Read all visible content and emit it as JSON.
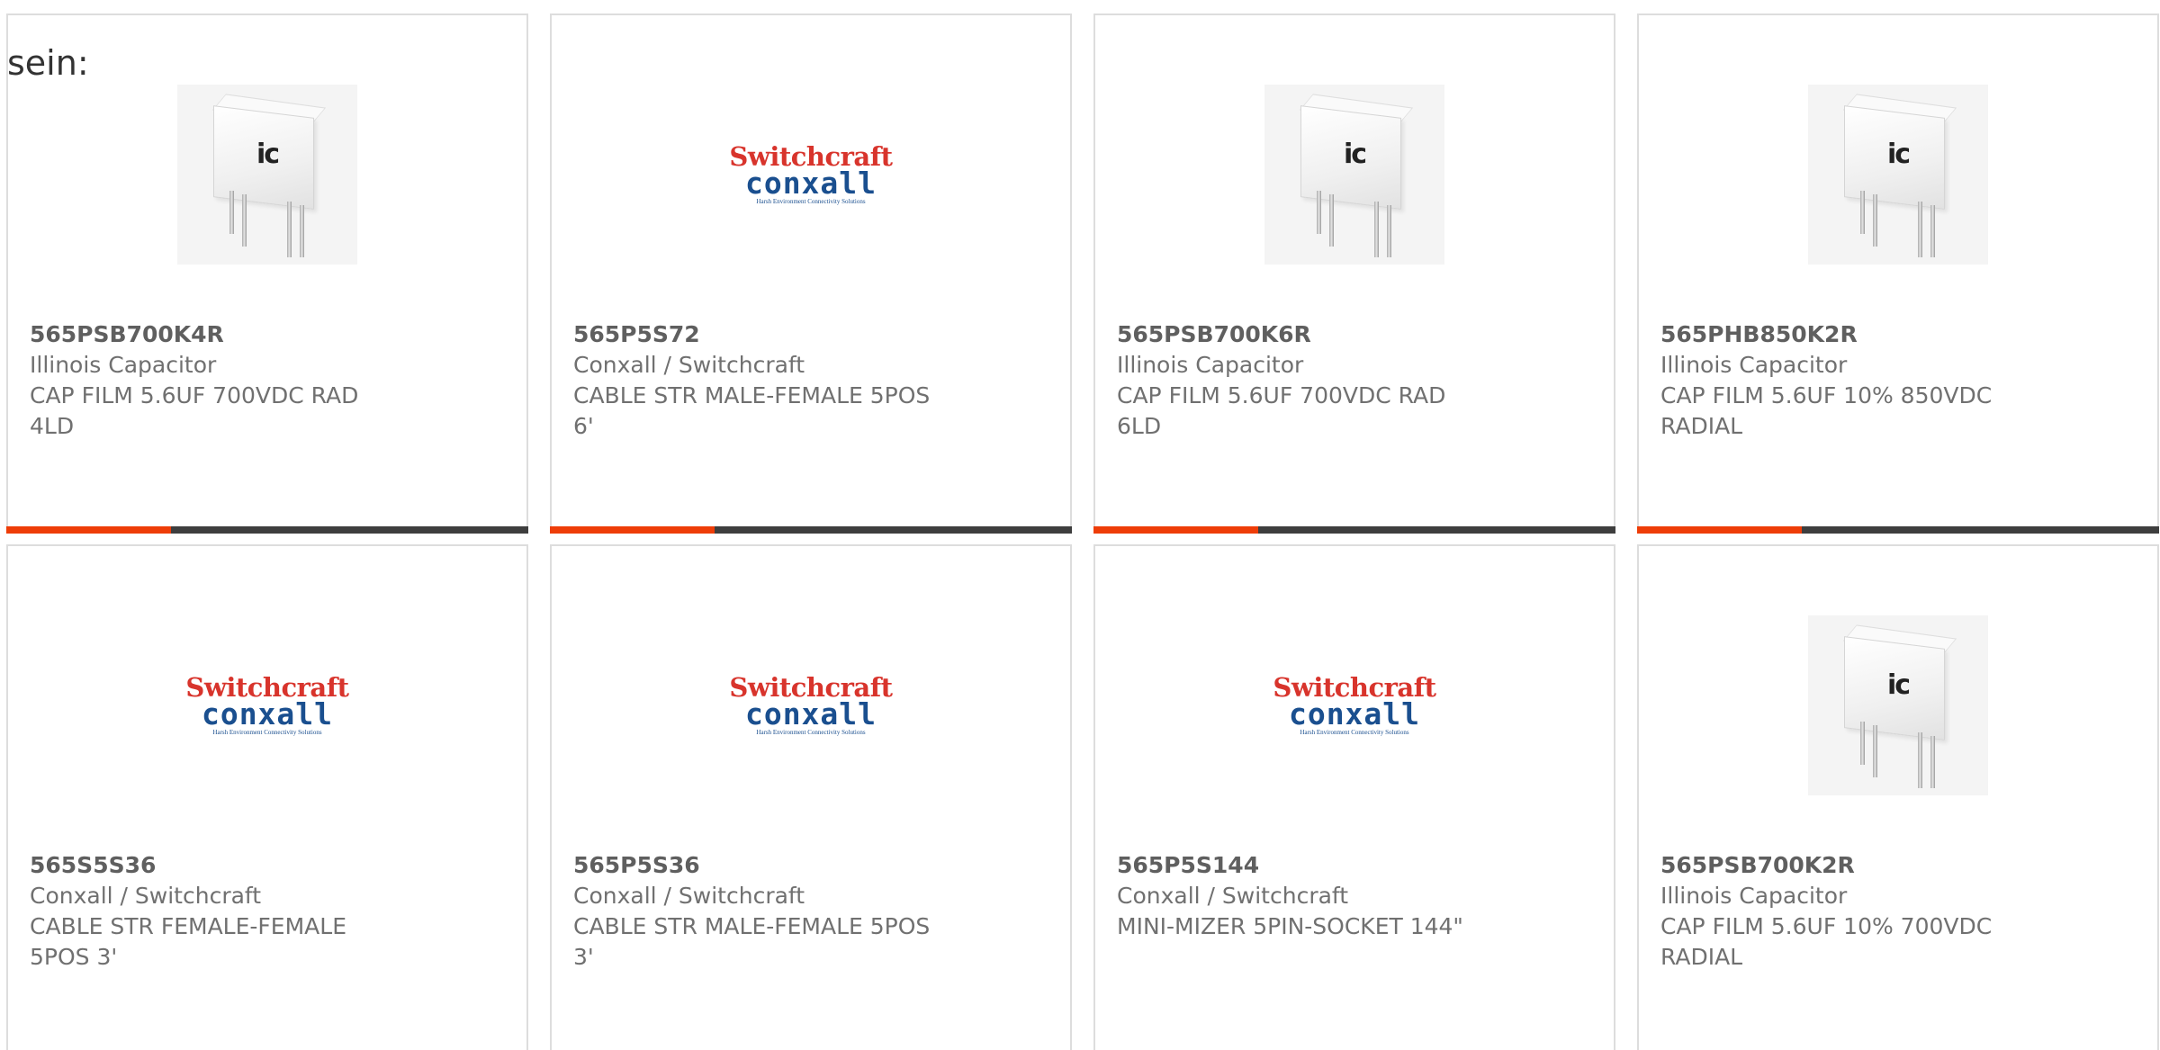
{
  "intro": {
    "text": "sein:"
  },
  "cards": [
    {
      "part_number": "565PSB700K4R",
      "manufacturer": "Illinois Capacitor",
      "description_line1": "CAP FILM 5.6UF 700VDC RAD",
      "description_line2": "4LD",
      "image": "ic-capacitor",
      "has_bar": true
    },
    {
      "part_number": "565P5S72",
      "manufacturer": "Conxall / Switchcraft",
      "description_line1": "CABLE STR MALE-FEMALE 5POS",
      "description_line2": "6'",
      "image": "switchcraft-conxall-logo",
      "has_bar": true
    },
    {
      "part_number": "565PSB700K6R",
      "manufacturer": "Illinois Capacitor",
      "description_line1": "CAP FILM 5.6UF 700VDC RAD",
      "description_line2": "6LD",
      "image": "ic-capacitor",
      "has_bar": true
    },
    {
      "part_number": "565PHB850K2R",
      "manufacturer": "Illinois Capacitor",
      "description_line1": "CAP FILM 5.6UF 10% 850VDC",
      "description_line2": "RADIAL",
      "image": "ic-capacitor",
      "has_bar": true
    },
    {
      "part_number": "565S5S36",
      "manufacturer": "Conxall / Switchcraft",
      "description_line1": "CABLE STR FEMALE-FEMALE",
      "description_line2": "5POS 3'",
      "image": "switchcraft-conxall-logo",
      "has_bar": false
    },
    {
      "part_number": "565P5S36",
      "manufacturer": "Conxall / Switchcraft",
      "description_line1": "CABLE STR MALE-FEMALE 5POS",
      "description_line2": "3'",
      "image": "switchcraft-conxall-logo",
      "has_bar": false
    },
    {
      "part_number": "565P5S144",
      "manufacturer": "Conxall / Switchcraft",
      "description_line1": "MINI-MIZER 5PIN-SOCKET 144\"",
      "description_line2": "",
      "image": "switchcraft-conxall-logo",
      "has_bar": false
    },
    {
      "part_number": "565PSB700K2R",
      "manufacturer": "Illinois Capacitor",
      "description_line1": "CAP FILM 5.6UF 10% 700VDC",
      "description_line2": "RADIAL",
      "image": "ic-capacitor",
      "has_bar": false
    }
  ],
  "logo": {
    "brand_top": "Switchcraft",
    "brand_bottom": "conxall",
    "tagline": "Harsh Environment Connectivity Solutions",
    "capacitor_mark": "ic"
  },
  "colors": {
    "accent": "#ee3d08",
    "bar_dark": "#3e3e3e",
    "switchcraft_red": "#d8342c",
    "conxall_blue": "#1a4f8f"
  }
}
